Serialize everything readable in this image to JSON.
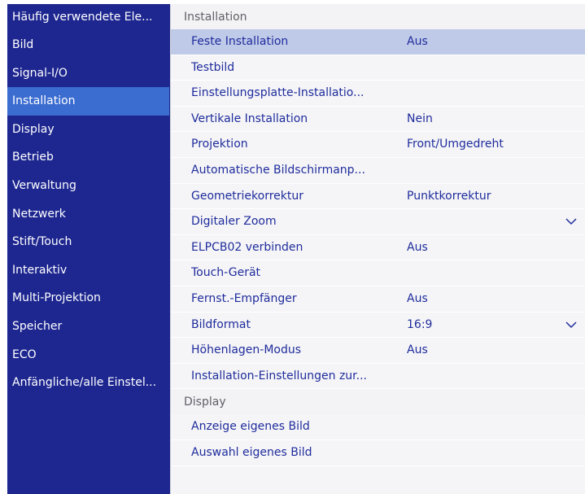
{
  "sidebar": {
    "items": [
      {
        "label": "Häufig verwendete Ele..."
      },
      {
        "label": "Bild"
      },
      {
        "label": "Signal-I/O"
      },
      {
        "label": "Installation"
      },
      {
        "label": "Display"
      },
      {
        "label": "Betrieb"
      },
      {
        "label": "Verwaltung"
      },
      {
        "label": "Netzwerk"
      },
      {
        "label": "Stift/Touch"
      },
      {
        "label": "Interaktiv"
      },
      {
        "label": "Multi-Projektion"
      },
      {
        "label": "Speicher"
      },
      {
        "label": "ECO"
      },
      {
        "label": "Anfängliche/alle Einstel..."
      }
    ],
    "selected": "Installation"
  },
  "main": {
    "installation_header": "Installation",
    "installation_rows": [
      {
        "label": "Feste Installation",
        "value": "Aus"
      },
      {
        "label": "Testbild",
        "value": ""
      },
      {
        "label": "Einstellungsplatte-Installatio...",
        "value": ""
      },
      {
        "label": "Vertikale Installation",
        "value": "Nein"
      },
      {
        "label": "Projektion",
        "value": "Front/Umgedreht"
      },
      {
        "label": "Automatische Bildschirmanp...",
        "value": ""
      },
      {
        "label": "Geometriekorrektur",
        "value": "Punktkorrektur"
      },
      {
        "label": "Digitaler Zoom",
        "value": ""
      },
      {
        "label": "ELPCB02 verbinden",
        "value": "Aus"
      },
      {
        "label": "Touch-Gerät",
        "value": ""
      },
      {
        "label": "Fernst.-Empfänger",
        "value": "Aus"
      },
      {
        "label": "Bildformat",
        "value": "16:9"
      },
      {
        "label": "Höhenlagen-Modus",
        "value": "Aus"
      },
      {
        "label": "Installation-Einstellungen zur...",
        "value": ""
      }
    ],
    "display_header": "Display",
    "display_rows": [
      {
        "label": "Anzeige eigenes Bild"
      },
      {
        "label": "Auswahl eigenes Bild"
      }
    ]
  },
  "icons": {
    "chevron": "chevron-down-icon"
  },
  "colors": {
    "sidebar_bg": "#1e2790",
    "sidebar_selected": "#3b6cd0",
    "row_selected": "#bfc9e8",
    "row_text": "#1f2c9c"
  }
}
